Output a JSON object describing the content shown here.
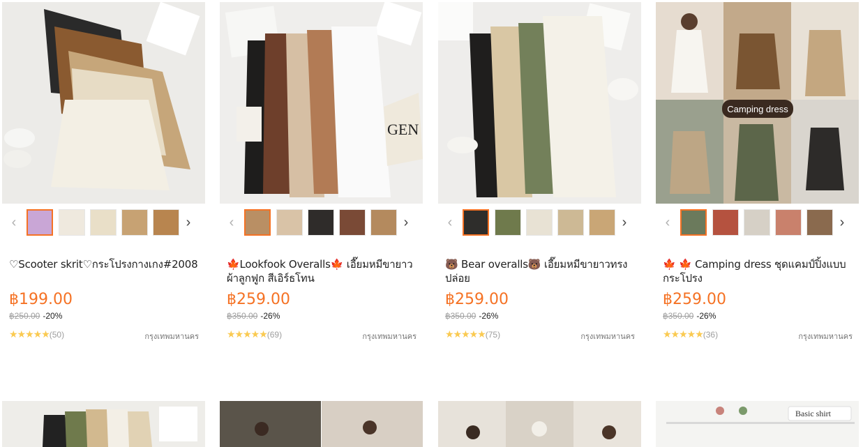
{
  "products": [
    {
      "title": "♡Scooter skrit♡กระโปรงกางเกง#2008",
      "price": "฿199.00",
      "original_price": "฿250.00",
      "discount": "-20%",
      "stars": "★★★★★",
      "reviews": "(50)",
      "location": "กรุงเทพมหานคร",
      "image_bg": "#ededeb",
      "thumb_colors": [
        "#c9a6d6",
        "#efe9de",
        "#e9dfc8",
        "#c7a273",
        "#b8854f"
      ]
    },
    {
      "title": "🍁Lookfook Overalls🍁 เอี๊ยมหมีขายาวผ้าลูกฟูก สีเอิร์ธโทน",
      "price": "฿259.00",
      "original_price": "฿350.00",
      "discount": "-26%",
      "stars": "★★★★★",
      "reviews": "(69)",
      "location": "กรุงเทพมหานคร",
      "image_bg": "#efeeec",
      "thumb_colors": [
        "#b98f64",
        "#d9c3a7",
        "#2f2c2a",
        "#7a4a36",
        "#b48a5e"
      ]
    },
    {
      "title": "🐻 Bear overalls🐻 เอี๊ยมหมีขายาวทรงปล่อย",
      "price": "฿259.00",
      "original_price": "฿350.00",
      "discount": "-26%",
      "stars": "★★★★★",
      "reviews": "(75)",
      "location": "กรุงเทพมหานคร",
      "image_bg": "#eeedeb",
      "thumb_colors": [
        "#2e2d2b",
        "#6f7a4c",
        "#e8e2d4",
        "#cdb995",
        "#c9a676"
      ]
    },
    {
      "title": "🍁 🍁 Camping dress ชุดแคมป์ปิ้งแบบกระโปรง",
      "price": "฿259.00",
      "original_price": "฿350.00",
      "discount": "-26%",
      "stars": "★★★★★",
      "reviews": "(36)",
      "location": "กรุงเทพมหานคร",
      "image_bg": "#d8cdbd",
      "image_tag": "Camping dress",
      "thumb_colors": [
        "#6b7a5c",
        "#b5523f",
        "#d6d0c6",
        "#c9816c",
        "#8a6a4e"
      ]
    }
  ],
  "second_row_labels": {
    "fourth": "Basic shirt"
  },
  "ui": {
    "prev_icon": "‹",
    "next_icon": "›",
    "accent_color": "#f57224"
  }
}
